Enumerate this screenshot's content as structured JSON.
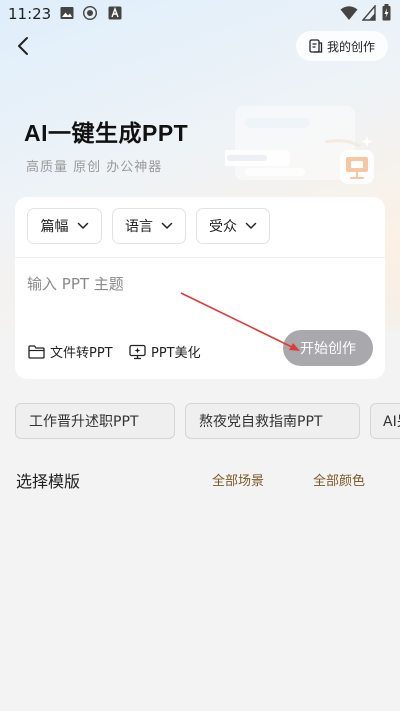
{
  "status_bar": {
    "time": "11:23",
    "icons": [
      "gallery-icon",
      "circle-app-icon",
      "text-a-icon",
      "wifi-icon",
      "signal-icon",
      "battery-icon"
    ]
  },
  "header": {
    "back_icon": "chevron-left-icon",
    "my_works_icon": "document-icon",
    "my_works_label": "我的创作"
  },
  "hero": {
    "title": "AI一键生成PPT",
    "subtitle": "高质量  原创  办公神器"
  },
  "card": {
    "dropdowns": [
      {
        "label": "篇幅",
        "icon": "chevron-down-icon"
      },
      {
        "label": "语言",
        "icon": "chevron-down-icon"
      },
      {
        "label": "受众",
        "icon": "chevron-down-icon"
      }
    ],
    "topic_placeholder": "输入 PPT 主题",
    "topic_value": "",
    "actions": [
      {
        "label": "文件转PPT",
        "icon": "folder-icon"
      },
      {
        "label": "PPT美化",
        "icon": "monitor-sparkle-icon"
      }
    ],
    "start_label": "开始创作"
  },
  "suggestions": [
    "工作晋升述职PPT",
    "熬夜党自救指南PPT",
    "AI另"
  ],
  "templates": {
    "title": "选择模版",
    "filters": [
      "全部场景",
      "全部颜色"
    ]
  },
  "colors": {
    "start_button": "#a9a9ad",
    "filter_text": "#7a5a2a",
    "arrow": "#e03a3a"
  }
}
